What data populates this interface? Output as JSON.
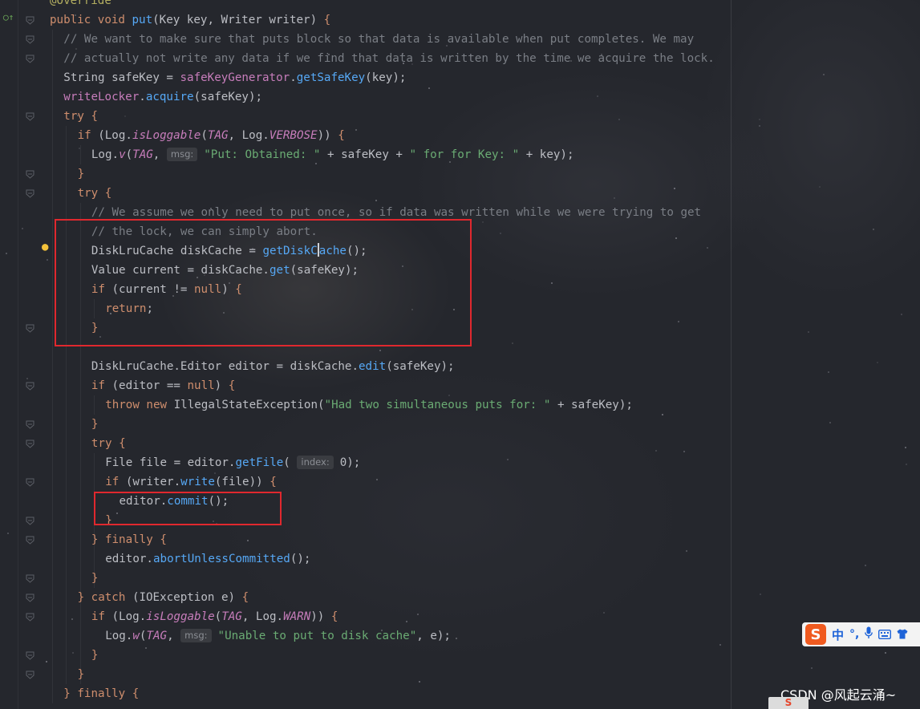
{
  "colors": {
    "keyword": "#cf8e6d",
    "method": "#56a8f5",
    "field": "#c77dbb",
    "string": "#6aab73",
    "comment": "#7a7e85",
    "static": "#c77dbb",
    "text": "#bcbec4",
    "annotation": "#b3ae60",
    "highlight_box": "#e0282e"
  },
  "gutter": {
    "override_icon": "override-implementation-icon",
    "bulb_icon": "lightbulb-icon"
  },
  "code": [
    {
      "indent": 0,
      "tokens": [
        {
          "t": "@Override",
          "c": "annotation"
        }
      ]
    },
    {
      "indent": 0,
      "tokens": [
        {
          "t": "public void ",
          "c": "keyword"
        },
        {
          "t": "put",
          "c": "method"
        },
        {
          "t": "(Key key, Writer writer) ",
          "c": "text"
        },
        {
          "t": "{",
          "c": "keyword"
        }
      ]
    },
    {
      "indent": 1,
      "tokens": [
        {
          "t": "// We want to make sure that puts block so that data is available when put completes. We may",
          "c": "comment"
        }
      ]
    },
    {
      "indent": 1,
      "tokens": [
        {
          "t": "// actually not write any data if we find that data is written by the time we acquire the lock.",
          "c": "comment"
        }
      ]
    },
    {
      "indent": 1,
      "tokens": [
        {
          "t": "String safeKey = ",
          "c": "text"
        },
        {
          "t": "safeKeyGenerator",
          "c": "field"
        },
        {
          "t": ".",
          "c": "text"
        },
        {
          "t": "getSafeKey",
          "c": "method"
        },
        {
          "t": "(key);",
          "c": "text"
        }
      ]
    },
    {
      "indent": 1,
      "tokens": [
        {
          "t": "writeLocker",
          "c": "field"
        },
        {
          "t": ".",
          "c": "text"
        },
        {
          "t": "acquire",
          "c": "method"
        },
        {
          "t": "(safeKey);",
          "c": "text"
        }
      ]
    },
    {
      "indent": 1,
      "tokens": [
        {
          "t": "try ",
          "c": "keyword"
        },
        {
          "t": "{",
          "c": "keyword"
        }
      ]
    },
    {
      "indent": 2,
      "tokens": [
        {
          "t": "if ",
          "c": "keyword"
        },
        {
          "t": "(Log.",
          "c": "text"
        },
        {
          "t": "isLoggable",
          "c": "static"
        },
        {
          "t": "(",
          "c": "text"
        },
        {
          "t": "TAG",
          "c": "static"
        },
        {
          "t": ", Log.",
          "c": "text"
        },
        {
          "t": "VERBOSE",
          "c": "static"
        },
        {
          "t": ")) ",
          "c": "text"
        },
        {
          "t": "{",
          "c": "keyword"
        }
      ]
    },
    {
      "indent": 3,
      "tokens": [
        {
          "t": "Log.",
          "c": "text"
        },
        {
          "t": "v",
          "c": "static"
        },
        {
          "t": "(",
          "c": "text"
        },
        {
          "t": "TAG",
          "c": "static"
        },
        {
          "t": ", ",
          "c": "text"
        },
        {
          "hint": "msg:"
        },
        {
          "t": "\"Put: Obtained: \"",
          "c": "string"
        },
        {
          "t": " + safeKey + ",
          "c": "text"
        },
        {
          "t": "\" for for Key: \"",
          "c": "string"
        },
        {
          "t": " + key);",
          "c": "text"
        }
      ]
    },
    {
      "indent": 2,
      "tokens": [
        {
          "t": "}",
          "c": "keyword"
        }
      ]
    },
    {
      "indent": 2,
      "tokens": [
        {
          "t": "try ",
          "c": "keyword"
        },
        {
          "t": "{",
          "c": "keyword"
        }
      ]
    },
    {
      "indent": 3,
      "tokens": [
        {
          "t": "// We assume we only need to put once, so if data was written while we were trying to get",
          "c": "comment"
        }
      ]
    },
    {
      "indent": 3,
      "tokens": [
        {
          "t": "// the lock, we can simply abort.",
          "c": "comment"
        }
      ]
    },
    {
      "indent": 3,
      "tokens": [
        {
          "t": "DiskLruCache diskCache = ",
          "c": "text"
        },
        {
          "t": "getDiskC",
          "c": "method"
        },
        {
          "caret": true
        },
        {
          "t": "ache",
          "c": "method"
        },
        {
          "t": "();",
          "c": "text"
        }
      ]
    },
    {
      "indent": 3,
      "tokens": [
        {
          "t": "Value current = diskCache.",
          "c": "text"
        },
        {
          "t": "get",
          "c": "method"
        },
        {
          "t": "(safeKey);",
          "c": "text"
        }
      ]
    },
    {
      "indent": 3,
      "tokens": [
        {
          "t": "if ",
          "c": "keyword"
        },
        {
          "t": "(current != ",
          "c": "text"
        },
        {
          "t": "null",
          "c": "keyword"
        },
        {
          "t": ") ",
          "c": "text"
        },
        {
          "t": "{",
          "c": "keyword"
        }
      ]
    },
    {
      "indent": 4,
      "tokens": [
        {
          "t": "return",
          "c": "keyword"
        },
        {
          "t": ";",
          "c": "text"
        }
      ]
    },
    {
      "indent": 3,
      "tokens": [
        {
          "t": "}",
          "c": "keyword"
        }
      ]
    },
    {
      "indent": 3,
      "tokens": []
    },
    {
      "indent": 3,
      "tokens": [
        {
          "t": "DiskLruCache.Editor editor = diskCache.",
          "c": "text"
        },
        {
          "t": "edit",
          "c": "method"
        },
        {
          "t": "(safeKey);",
          "c": "text"
        }
      ]
    },
    {
      "indent": 3,
      "tokens": [
        {
          "t": "if ",
          "c": "keyword"
        },
        {
          "t": "(editor == ",
          "c": "text"
        },
        {
          "t": "null",
          "c": "keyword"
        },
        {
          "t": ") ",
          "c": "text"
        },
        {
          "t": "{",
          "c": "keyword"
        }
      ]
    },
    {
      "indent": 4,
      "tokens": [
        {
          "t": "throw new ",
          "c": "keyword"
        },
        {
          "t": "IllegalStateException(",
          "c": "text"
        },
        {
          "t": "\"Had two simultaneous puts for: \"",
          "c": "string"
        },
        {
          "t": " + safeKey);",
          "c": "text"
        }
      ]
    },
    {
      "indent": 3,
      "tokens": [
        {
          "t": "}",
          "c": "keyword"
        }
      ]
    },
    {
      "indent": 3,
      "tokens": [
        {
          "t": "try ",
          "c": "keyword"
        },
        {
          "t": "{",
          "c": "keyword"
        }
      ]
    },
    {
      "indent": 4,
      "tokens": [
        {
          "t": "File file = editor.",
          "c": "text"
        },
        {
          "t": "getFile",
          "c": "method"
        },
        {
          "t": "( ",
          "c": "text"
        },
        {
          "hint": "index:"
        },
        {
          "t": "0);",
          "c": "text"
        }
      ]
    },
    {
      "indent": 4,
      "tokens": [
        {
          "t": "if ",
          "c": "keyword"
        },
        {
          "t": "(writer.",
          "c": "text"
        },
        {
          "t": "write",
          "c": "method"
        },
        {
          "t": "(file)) ",
          "c": "text"
        },
        {
          "t": "{",
          "c": "keyword"
        }
      ]
    },
    {
      "indent": 5,
      "tokens": [
        {
          "t": "editor.",
          "c": "text"
        },
        {
          "t": "commit",
          "c": "method"
        },
        {
          "t": "();",
          "c": "text"
        }
      ]
    },
    {
      "indent": 4,
      "tokens": [
        {
          "t": "}",
          "c": "keyword"
        }
      ]
    },
    {
      "indent": 3,
      "tokens": [
        {
          "t": "} finally ",
          "c": "keyword"
        },
        {
          "t": "{",
          "c": "keyword"
        }
      ]
    },
    {
      "indent": 4,
      "tokens": [
        {
          "t": "editor.",
          "c": "text"
        },
        {
          "t": "abortUnlessCommitted",
          "c": "method"
        },
        {
          "t": "();",
          "c": "text"
        }
      ]
    },
    {
      "indent": 3,
      "tokens": [
        {
          "t": "}",
          "c": "keyword"
        }
      ]
    },
    {
      "indent": 2,
      "tokens": [
        {
          "t": "} catch ",
          "c": "keyword"
        },
        {
          "t": "(IOException e) ",
          "c": "text"
        },
        {
          "t": "{",
          "c": "keyword"
        }
      ]
    },
    {
      "indent": 3,
      "tokens": [
        {
          "t": "if ",
          "c": "keyword"
        },
        {
          "t": "(Log.",
          "c": "text"
        },
        {
          "t": "isLoggable",
          "c": "static"
        },
        {
          "t": "(",
          "c": "text"
        },
        {
          "t": "TAG",
          "c": "static"
        },
        {
          "t": ", Log.",
          "c": "text"
        },
        {
          "t": "WARN",
          "c": "static"
        },
        {
          "t": ")) ",
          "c": "text"
        },
        {
          "t": "{",
          "c": "keyword"
        }
      ]
    },
    {
      "indent": 4,
      "tokens": [
        {
          "t": "Log.",
          "c": "text"
        },
        {
          "t": "w",
          "c": "static"
        },
        {
          "t": "(",
          "c": "text"
        },
        {
          "t": "TAG",
          "c": "static"
        },
        {
          "t": ", ",
          "c": "text"
        },
        {
          "hint": "msg:"
        },
        {
          "t": "\"Unable to put to disk cache\"",
          "c": "string"
        },
        {
          "t": ", e);",
          "c": "text"
        }
      ]
    },
    {
      "indent": 3,
      "tokens": [
        {
          "t": "}",
          "c": "keyword"
        }
      ]
    },
    {
      "indent": 2,
      "tokens": [
        {
          "t": "}",
          "c": "keyword"
        }
      ]
    },
    {
      "indent": 1,
      "tokens": [
        {
          "t": "} finally ",
          "c": "keyword"
        },
        {
          "t": "{",
          "c": "keyword"
        }
      ]
    }
  ],
  "ime": {
    "logo": "S",
    "mode": "中",
    "punct": "°,",
    "mic_icon": "microphone-icon",
    "keyboard_icon": "keyboard-icon",
    "skin_icon": "shirt-icon"
  },
  "watermark": "CSDN @风起云涌~",
  "mini_logo": "S"
}
